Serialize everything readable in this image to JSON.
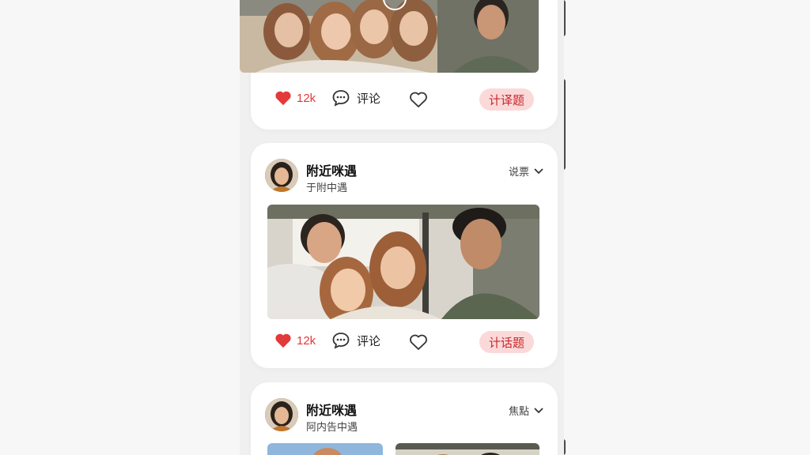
{
  "top_card": {
    "like_count": "12k",
    "comment_label": "评论",
    "topic_label": "计译题"
  },
  "cards": [
    {
      "author": "附近咪遇",
      "subtitle": "于附中遇",
      "sort_label": "说票",
      "like_count": "12k",
      "comment_label": "评论",
      "topic_label": "计话题"
    },
    {
      "author": "附近咪遇",
      "subtitle": "阿内告中遇",
      "sort_label": "焦點"
    }
  ],
  "colors": {
    "accent": "#e2393b",
    "topic_bg": "#fbd9d9",
    "topic_text": "#c9262a"
  },
  "icons": [
    "heart-filled-icon",
    "comment-bubble-icon",
    "heart-outline-icon",
    "chevron-down-icon"
  ]
}
